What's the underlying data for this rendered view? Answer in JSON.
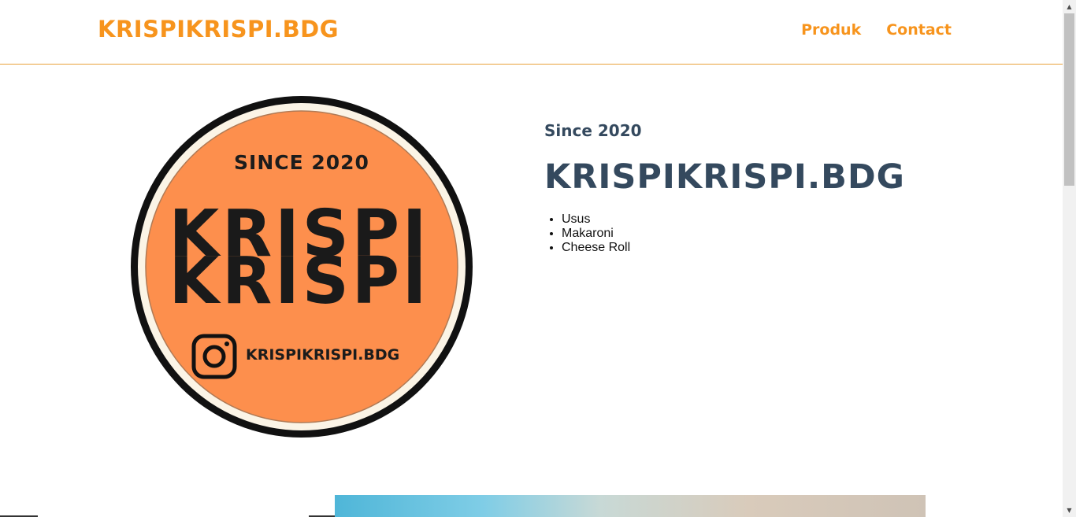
{
  "navbar": {
    "brand": "KRISPIKRISPI.BDG",
    "links": [
      "Produk",
      "Contact"
    ]
  },
  "hero": {
    "logo": {
      "top_text": "SINCE 2020",
      "word_line_1": "KRISPI",
      "word_line_2": "KRISPI",
      "instagram_handle": "KRISPIKRISPI.BDG"
    },
    "since": "Since 2020",
    "title": "KRISPIKRISPI.BDG",
    "products": [
      "Usus",
      "Makaroni",
      "Cheese Roll"
    ]
  },
  "colors": {
    "accent": "#f7941d",
    "heading": "#34495e",
    "logo_fill": "#fd8f4d",
    "logo_ring": "#111111"
  },
  "icons": {
    "logo_badge": "instagram-icon",
    "scroll_up": "chevron-up-icon",
    "scroll_down": "chevron-down-icon"
  }
}
